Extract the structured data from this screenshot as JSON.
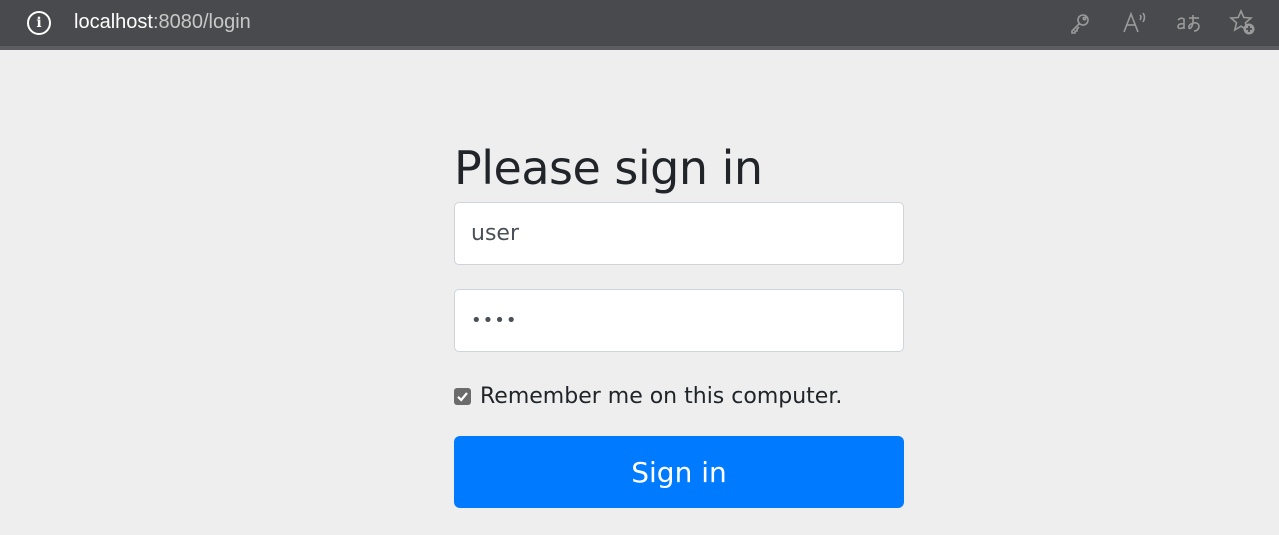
{
  "browser": {
    "url_host": "localhost",
    "url_rest": ":8080/login",
    "info_glyph": "i",
    "icons": [
      "key-icon",
      "read-aloud-icon",
      "translate-icon",
      "add-favorite-icon"
    ]
  },
  "login": {
    "heading": "Please sign in",
    "username_value": "user",
    "password_mask": "••••",
    "remember_label": "Remember me on this computer.",
    "remember_checked": true,
    "submit_label": "Sign in"
  },
  "colors": {
    "page_bg": "#eeeeee",
    "browser_bar": "#494a4e",
    "primary_button": "#007bff",
    "checkbox": "#6b6b6b"
  }
}
